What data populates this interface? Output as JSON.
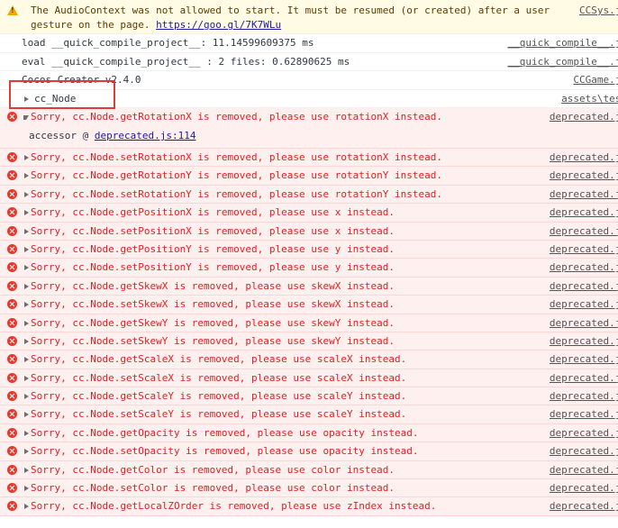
{
  "warning": {
    "text": "The AudioContext was not allowed to start. It must be resumed (or created) after a user gesture on the page.",
    "link": "https://goo.gl/7K7WLu",
    "source": "CCSys.js"
  },
  "logs": [
    {
      "text": "load __quick_compile_project__: 11.14599609375 ms",
      "source": "__quick_compile__.js"
    },
    {
      "text": "eval __quick_compile_project__ : 2 files: 0.62890625 ms",
      "source": "__quick_compile__.js"
    },
    {
      "text": "Cocos Creator v2.4.0",
      "source": "CCGame.js"
    }
  ],
  "group": {
    "text": "cc_Node",
    "source": "assets\\test"
  },
  "expanded_error": {
    "text": "Sorry, cc.Node.getRotationX is removed, please use rotationX instead.",
    "source": "deprecated.js",
    "sub_prefix": "accessor @ ",
    "sub_link": "deprecated.js:114"
  },
  "errors": [
    {
      "text": "Sorry, cc.Node.setRotationX is removed, please use rotationX instead.",
      "source": "deprecated.js"
    },
    {
      "text": "Sorry, cc.Node.getRotationY is removed, please use rotationY instead.",
      "source": "deprecated.js"
    },
    {
      "text": "Sorry, cc.Node.setRotationY is removed, please use rotationY instead.",
      "source": "deprecated.js"
    },
    {
      "text": "Sorry, cc.Node.getPositionX is removed, please use x instead.",
      "source": "deprecated.js"
    },
    {
      "text": "Sorry, cc.Node.setPositionX is removed, please use x instead.",
      "source": "deprecated.js"
    },
    {
      "text": "Sorry, cc.Node.getPositionY is removed, please use y instead.",
      "source": "deprecated.js"
    },
    {
      "text": "Sorry, cc.Node.setPositionY is removed, please use y instead.",
      "source": "deprecated.js"
    },
    {
      "text": "Sorry, cc.Node.getSkewX is removed, please use skewX instead.",
      "source": "deprecated.js"
    },
    {
      "text": "Sorry, cc.Node.setSkewX is removed, please use skewX instead.",
      "source": "deprecated.js"
    },
    {
      "text": "Sorry, cc.Node.getSkewY is removed, please use skewY instead.",
      "source": "deprecated.js"
    },
    {
      "text": "Sorry, cc.Node.setSkewY is removed, please use skewY instead.",
      "source": "deprecated.js"
    },
    {
      "text": "Sorry, cc.Node.getScaleX is removed, please use scaleX instead.",
      "source": "deprecated.js"
    },
    {
      "text": "Sorry, cc.Node.setScaleX is removed, please use scaleX instead.",
      "source": "deprecated.js"
    },
    {
      "text": "Sorry, cc.Node.getScaleY is removed, please use scaleY instead.",
      "source": "deprecated.js"
    },
    {
      "text": "Sorry, cc.Node.setScaleY is removed, please use scaleY instead.",
      "source": "deprecated.js"
    },
    {
      "text": "Sorry, cc.Node.getOpacity is removed, please use opacity instead.",
      "source": "deprecated.js"
    },
    {
      "text": "Sorry, cc.Node.setOpacity is removed, please use opacity instead.",
      "source": "deprecated.js"
    },
    {
      "text": "Sorry, cc.Node.getColor is removed, please use color instead.",
      "source": "deprecated.js"
    },
    {
      "text": "Sorry, cc.Node.setColor is removed, please use color instead.",
      "source": "deprecated.js"
    },
    {
      "text": "Sorry, cc.Node.getLocalZOrder is removed, please use zIndex instead.",
      "source": "deprecated.js"
    }
  ],
  "colors": {
    "warning_bg": "#fffbe5",
    "error_bg": "#fff0f0",
    "error_text": "#e12020",
    "link": "#1a1aa6",
    "highlight": "#e03a3a"
  }
}
